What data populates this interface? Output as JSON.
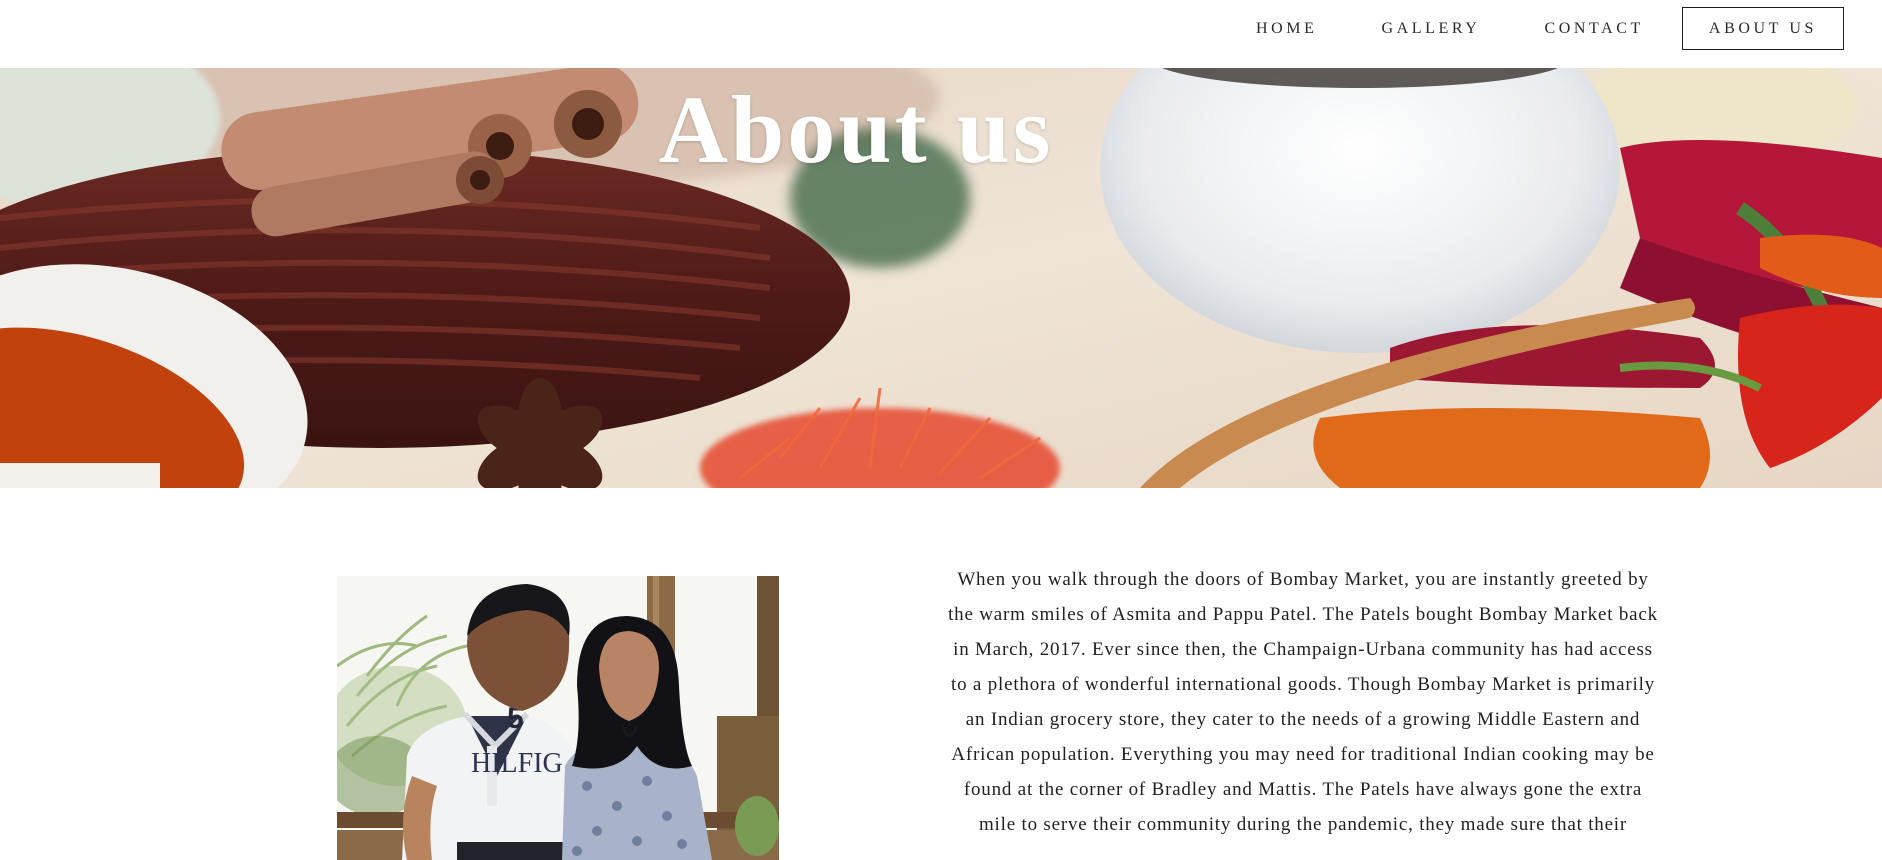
{
  "nav": {
    "items": [
      {
        "label": "HOME",
        "active": false
      },
      {
        "label": "GALLERY",
        "active": false
      },
      {
        "label": "CONTACT",
        "active": false
      },
      {
        "label": "ABOUT US",
        "active": true
      }
    ]
  },
  "hero": {
    "title": "About us",
    "background": "spices-photo"
  },
  "owners_photo": {
    "shirt_text": "HILFIG",
    "shirt_number": "5"
  },
  "story": {
    "paragraph": "When you walk through the doors of Bombay Market, you are instantly greeted by the warm smiles of Asmita and Pappu Patel. The Patels bought Bombay Market back in March, 2017. Ever since then, the Champaign-Urbana community has had access to a plethora of wonderful international goods. Though Bombay Market is primarily an Indian grocery store, they cater to the needs of a growing Middle Eastern and African population. Everything you may need for traditional Indian cooking may be found at the corner of Bradley and Mattis. The Patels have always gone the extra mile to serve their community during the pandemic, they made sure that their"
  },
  "colors": {
    "text": "#1f1f1f",
    "nav_border": "#1e1e1e",
    "hero_title": "#ffffff",
    "page_bg": "#ffffff"
  }
}
